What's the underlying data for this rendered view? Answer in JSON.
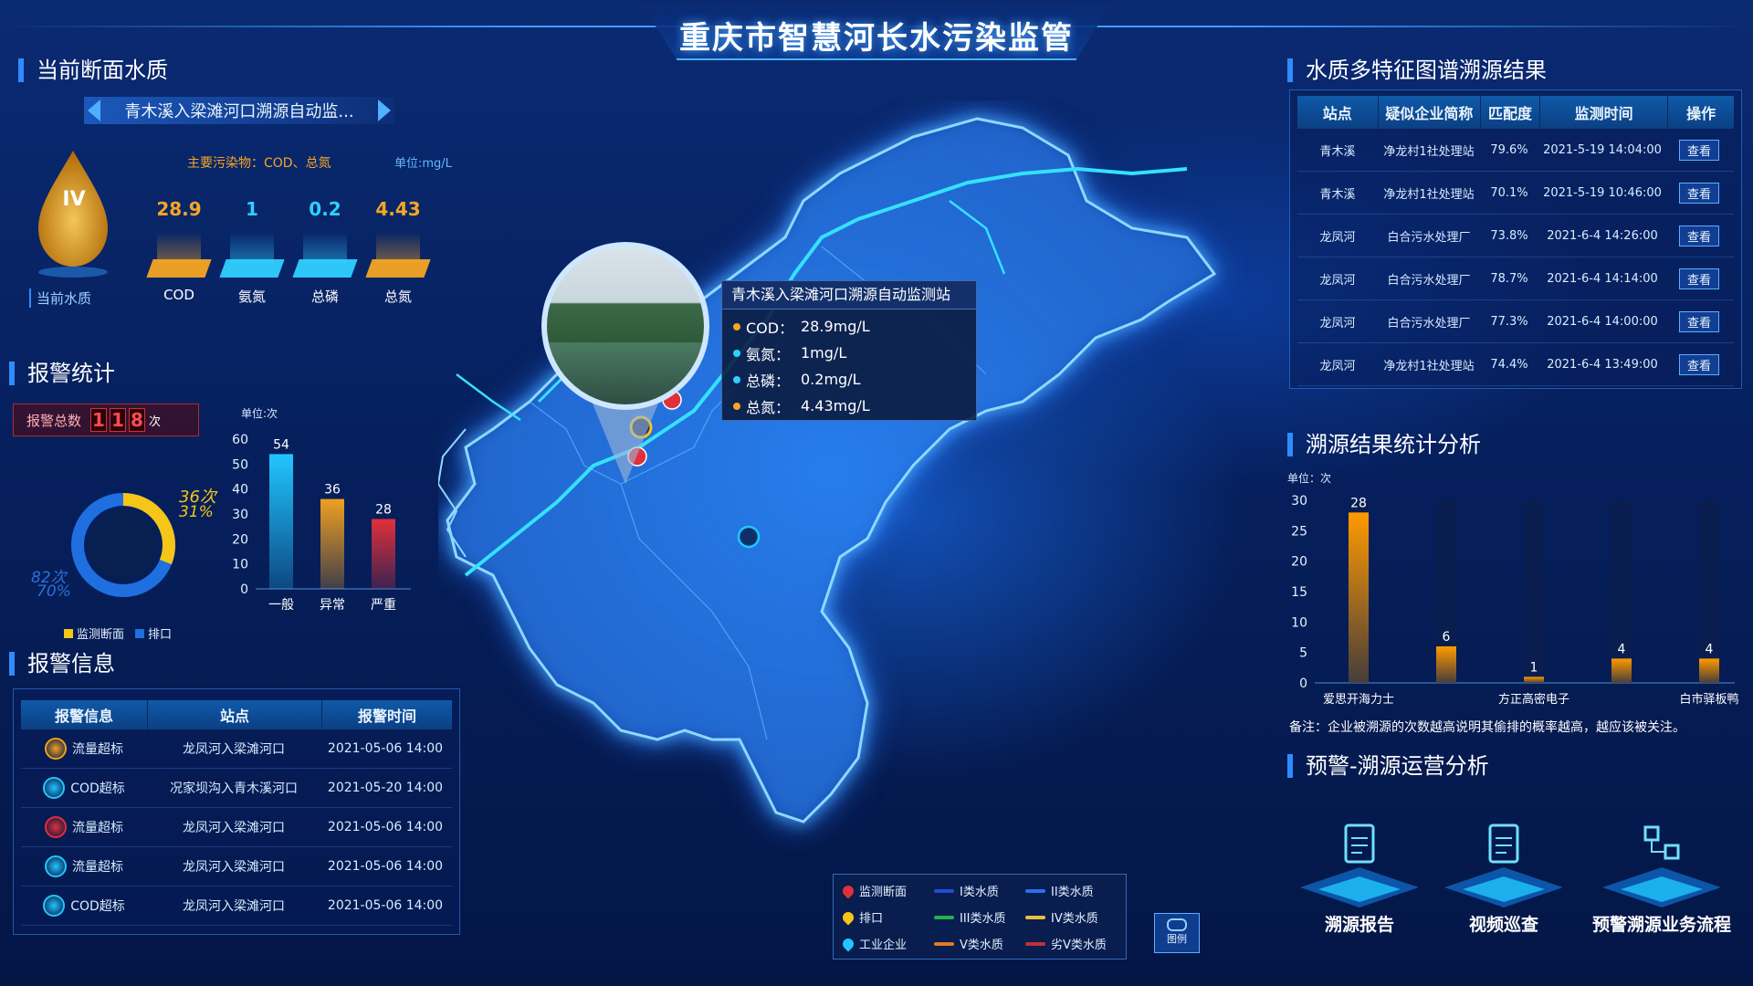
{
  "title": "重庆市智慧河长水污染监管",
  "water_quality": {
    "section_title": "当前断面水质",
    "station_name": "青木溪入梁滩河口溯源自动监...",
    "main_pollutants": "主要污染物：COD、总氮",
    "unit": "单位:mg/L",
    "grade": "IV",
    "grade_label": "当前水质",
    "metrics": [
      {
        "value": "28.9",
        "label": "COD",
        "color": "#f5a623"
      },
      {
        "value": "1",
        "label": "氨氮",
        "color": "#2fd0ff"
      },
      {
        "value": "0.2",
        "label": "总磷",
        "color": "#2fd0ff"
      },
      {
        "value": "4.43",
        "label": "总氮",
        "color": "#f5a623"
      }
    ]
  },
  "alarm_stats": {
    "section_title": "报警统计",
    "total_label": "报警总数",
    "total_digits": [
      "1",
      "1",
      "8"
    ],
    "total_unit": "次",
    "donut": {
      "a_count": "36次",
      "a_pct": "31%",
      "b_count": "82次",
      "b_pct": "70%"
    },
    "legend": [
      {
        "name": "监测断面",
        "color": "#f5c518"
      },
      {
        "name": "排口",
        "color": "#1f6fe0"
      }
    ]
  },
  "chart_data": [
    {
      "type": "bar",
      "ylabel": "单位:次",
      "ylim": [
        0,
        60
      ],
      "yticks": [
        0,
        10,
        20,
        30,
        40,
        50,
        60
      ],
      "categories": [
        "一般",
        "异常",
        "严重"
      ],
      "values": [
        54,
        36,
        28
      ],
      "colors": [
        "#21c6ff",
        "#f0a020",
        "#e0303a"
      ]
    },
    {
      "type": "bar",
      "ylabel": "单位：次",
      "ylim": [
        0,
        30
      ],
      "yticks": [
        0,
        5,
        10,
        15,
        20,
        25,
        30
      ],
      "categories": [
        "爱思开海力士",
        "",
        "方正高密电子",
        "",
        "白市驿板鸭"
      ],
      "values": [
        28,
        6,
        1,
        4,
        4
      ],
      "colors": [
        "#ff9a00",
        "#ff9a00",
        "#ff9a00",
        "#ff9a00",
        "#ff9a00"
      ]
    }
  ],
  "alarm_info": {
    "section_title": "报警信息",
    "headers": [
      "报警信息",
      "站点",
      "报警时间"
    ],
    "rows": [
      {
        "type": "流量超标",
        "site": "龙凤河入梁滩河口",
        "time": "2021-05-06 14:00",
        "color": "#f0a020"
      },
      {
        "type": "COD超标",
        "site": "况家坝沟入青木溪河口",
        "time": "2021-05-20 14:00",
        "color": "#21c6ff"
      },
      {
        "type": "流量超标",
        "site": "龙凤河入梁滩河口",
        "time": "2021-05-06 14:00",
        "color": "#e0303a"
      },
      {
        "type": "流量超标",
        "site": "龙凤河入梁滩河口",
        "time": "2021-05-06 14:00",
        "color": "#21c6ff"
      },
      {
        "type": "COD超标",
        "site": "龙凤河入梁滩河口",
        "time": "2021-05-06 14:00",
        "color": "#21c6ff"
      }
    ]
  },
  "popup": {
    "title": "青木溪入梁滩河口溯源自动监测站",
    "items": [
      {
        "name": "COD：",
        "value": "28.9mg/L",
        "color": "#f5a623"
      },
      {
        "name": "氨氮：",
        "value": "1mg/L",
        "color": "#2fd0ff"
      },
      {
        "name": "总磷：",
        "value": "0.2mg/L",
        "color": "#2fd0ff"
      },
      {
        "name": "总氮：",
        "value": "4.43mg/L",
        "color": "#f5a623"
      }
    ]
  },
  "legend": {
    "items": [
      {
        "label": "监测断面",
        "kind": "marker",
        "color": "#e0303a"
      },
      {
        "label": "I类水质",
        "kind": "line",
        "color": "#1e4fd6"
      },
      {
        "label": "II类水质",
        "kind": "line",
        "color": "#2a6ff0"
      },
      {
        "label": "排口",
        "kind": "marker",
        "color": "#f5c518"
      },
      {
        "label": "III类水质",
        "kind": "line",
        "color": "#25b04a"
      },
      {
        "label": "IV类水质",
        "kind": "line",
        "color": "#e3c13a"
      },
      {
        "label": "工业企业",
        "kind": "marker",
        "color": "#21c6ff"
      },
      {
        "label": "V类水质",
        "kind": "line",
        "color": "#e07a2a"
      },
      {
        "label": "劣V类水质",
        "kind": "line",
        "color": "#c0303a"
      }
    ],
    "button_label": "图例"
  },
  "trace_results": {
    "section_title": "水质多特征图谱溯源结果",
    "headers": [
      "站点",
      "疑似企业简称",
      "匹配度",
      "监测时间",
      "操作"
    ],
    "rows": [
      {
        "site": "青木溪",
        "company": "净龙村1社处理站",
        "match": "79.6%",
        "time": "2021-5-19 14:04:00",
        "op": "查看"
      },
      {
        "site": "青木溪",
        "company": "净龙村1社处理站",
        "match": "70.1%",
        "time": "2021-5-19 10:46:00",
        "op": "查看"
      },
      {
        "site": "龙凤河",
        "company": "白合污水处理厂",
        "match": "73.8%",
        "time": "2021-6-4 14:26:00",
        "op": "查看"
      },
      {
        "site": "龙凤河",
        "company": "白合污水处理厂",
        "match": "78.7%",
        "time": "2021-6-4 14:14:00",
        "op": "查看"
      },
      {
        "site": "龙凤河",
        "company": "白合污水处理厂",
        "match": "77.3%",
        "time": "2021-6-4 14:00:00",
        "op": "查看"
      },
      {
        "site": "龙凤河",
        "company": "净龙村1社处理站",
        "match": "74.4%",
        "time": "2021-6-4 13:49:00",
        "op": "查看"
      }
    ]
  },
  "trace_stats": {
    "section_title": "溯源结果统计分析",
    "note": "备注：企业被溯源的次数越高说明其偷排的概率越高，越应该被关注。"
  },
  "operations": {
    "section_title": "预警-溯源运营分析",
    "cards": [
      {
        "label": "溯源报告"
      },
      {
        "label": "视频巡查"
      },
      {
        "label": "预警溯源业务流程"
      }
    ]
  }
}
